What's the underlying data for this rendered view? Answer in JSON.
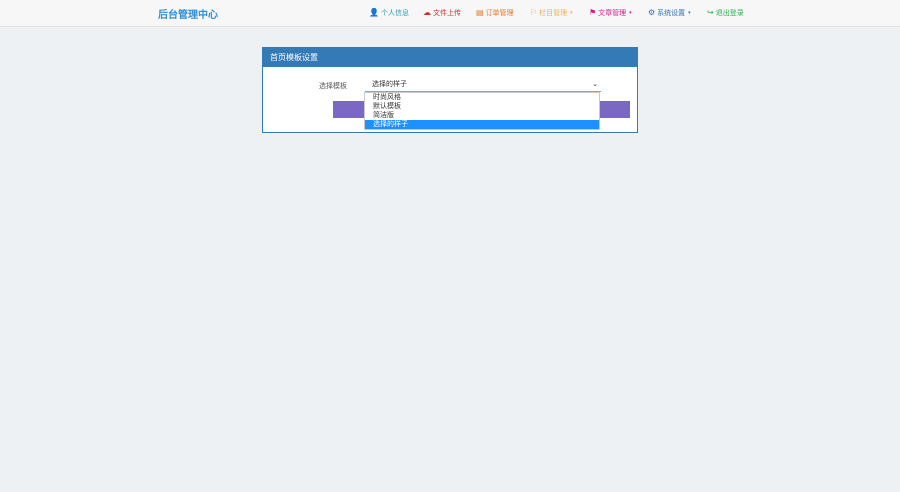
{
  "brand": "后台管理中心",
  "nav": [
    {
      "label": "个人信息",
      "icon": "user-icon",
      "glyph": "👤",
      "color": "#2a9db6",
      "caret": ""
    },
    {
      "label": "文件上传",
      "icon": "cloud-icon",
      "glyph": "☁",
      "color": "#d9282f",
      "caret": ""
    },
    {
      "label": "订单管理",
      "icon": "list-icon",
      "glyph": "▤",
      "color": "#e8731e",
      "caret": ""
    },
    {
      "label": "栏目管理",
      "icon": "flag-icon",
      "glyph": "⚐",
      "color": "#f0ad4e",
      "caret": "▾"
    },
    {
      "label": "文章管理",
      "icon": "flag-icon",
      "glyph": "⚑",
      "color": "#d6178a",
      "caret": "▾"
    },
    {
      "label": "系统设置",
      "icon": "gear-icon",
      "glyph": "⚙",
      "color": "#2f74bf",
      "caret": "▾"
    },
    {
      "label": "退出登录",
      "icon": "logout-icon",
      "glyph": "↪",
      "color": "#26b24b",
      "caret": ""
    }
  ],
  "panel": {
    "title": "首页模板设置",
    "field_label": "选择模板",
    "selected": "选择的样子",
    "options": [
      "时尚风格",
      "默认模板",
      "简洁版",
      "选择的样子"
    ]
  }
}
